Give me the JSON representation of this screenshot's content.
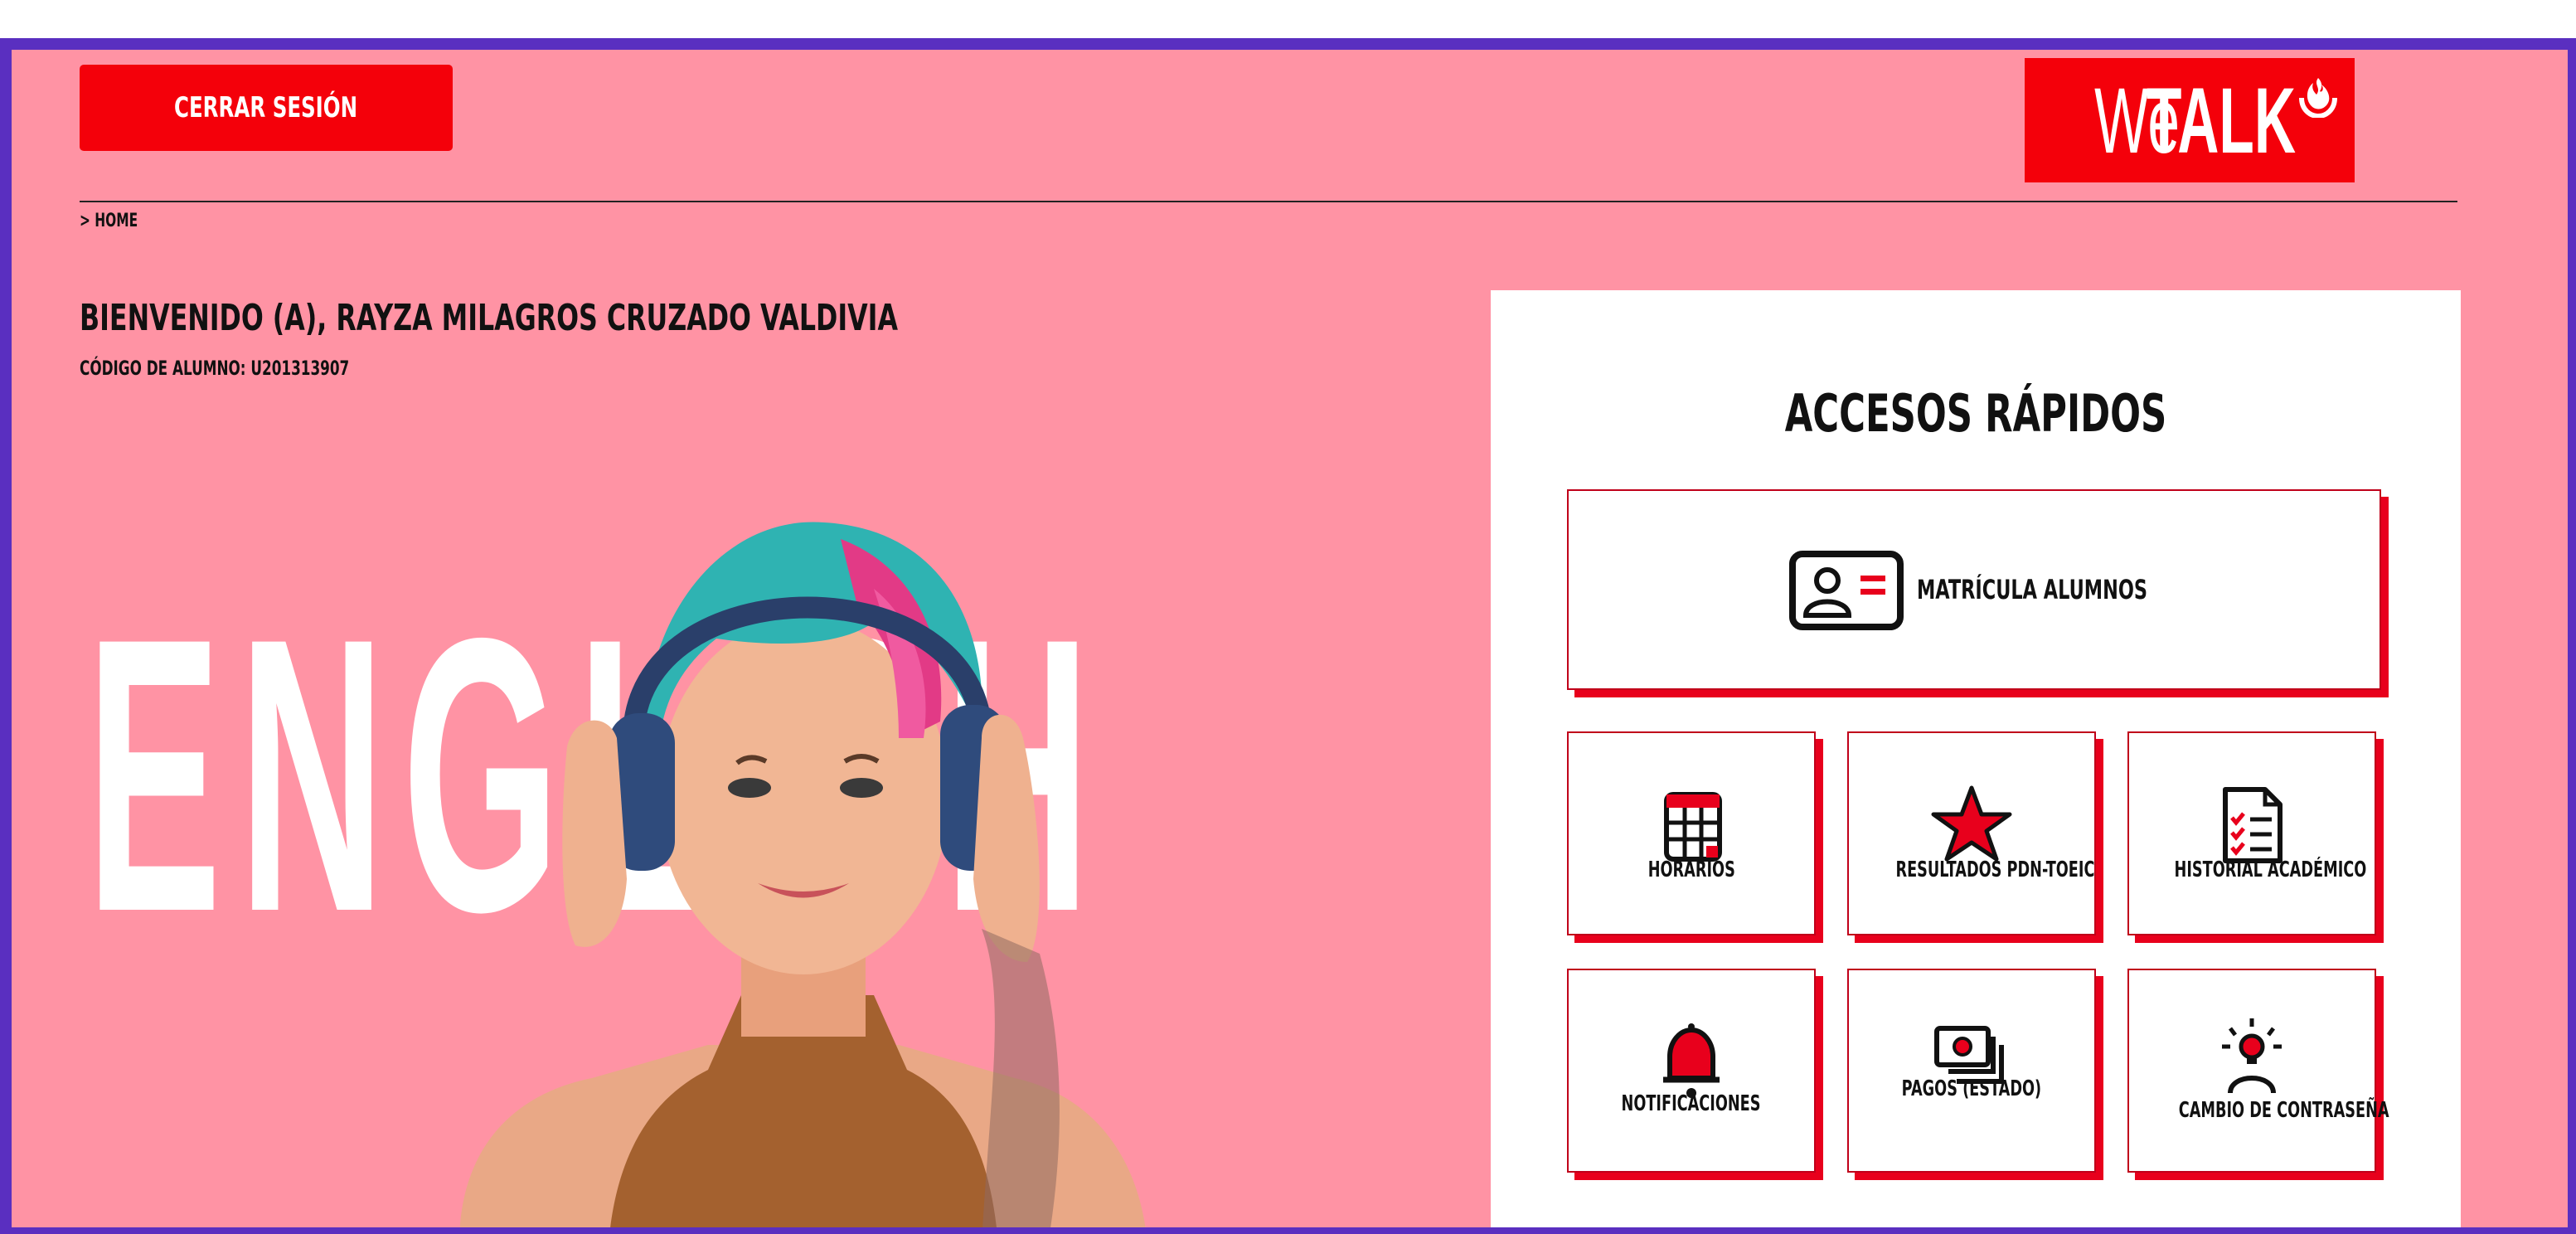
{
  "header": {
    "logout_label": "CERRAR SESIÓN",
    "brand_we": "We",
    "brand_talk": "TALK"
  },
  "breadcrumb": "> HOME",
  "welcome": {
    "title": "BIENVENIDO (A), RAYZA MILAGROS CRUZADO VALDIVIA",
    "code": "CÓDIGO DE ALUMNO: U201313907"
  },
  "hero": {
    "word": "ENGLISH"
  },
  "quick_access": {
    "title": "ACCESOS RÁPIDOS",
    "tiles": [
      {
        "label": "MATRÍCULA ALUMNOS",
        "icon": "id-card-icon"
      },
      {
        "label": "HORARIOS",
        "icon": "calendar-icon"
      },
      {
        "label": "RESULTADOS PDN-TOEIC",
        "icon": "star-icon"
      },
      {
        "label": "HISTORIAL ACADÉMICO",
        "icon": "checklist-document-icon"
      },
      {
        "label": "NOTIFICACIONES",
        "icon": "bell-icon"
      },
      {
        "label": "PAGOS (ESTADO)",
        "icon": "money-bills-icon"
      },
      {
        "label": "CAMBIO DE CONTRASEÑA",
        "icon": "lightbulb-user-icon"
      }
    ]
  },
  "colors": {
    "page_background": "#ff93a4",
    "frame": "#5a2fc0",
    "accent_red": "#f4000a"
  }
}
